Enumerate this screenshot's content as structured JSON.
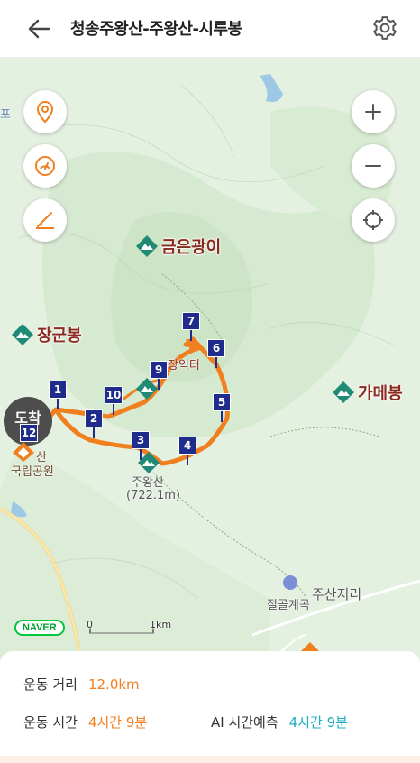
{
  "header": {
    "title": "청송주왕산-주왕산-시루봉",
    "back_icon": "arrow-left-icon",
    "settings_icon": "gear-icon"
  },
  "map": {
    "controls_left": [
      {
        "name": "location-pin-button",
        "icon": "location-pin-icon"
      },
      {
        "name": "speedometer-button",
        "icon": "speedometer-icon"
      },
      {
        "name": "elevation-slope-button",
        "icon": "slope-icon"
      }
    ],
    "controls_right": [
      {
        "name": "zoom-in-button",
        "icon": "plus-icon"
      },
      {
        "name": "zoom-out-button",
        "icon": "minus-icon"
      },
      {
        "name": "my-location-button",
        "icon": "crosshair-icon"
      }
    ],
    "peaks": [
      {
        "label": "금은광이"
      },
      {
        "label": "장군봉"
      },
      {
        "label": "가메봉"
      },
      {
        "label": ""
      }
    ],
    "summit_label": "주왕산",
    "summit_elevation": "(722.1m)",
    "park_label": "국립공원",
    "park_label_partial": "산",
    "edge_label": "포",
    "temple_label": "절골계곡",
    "area_label": "주산지리",
    "peak_partial_label": "장익터",
    "waypoints": [
      "1",
      "2",
      "3",
      "4",
      "5",
      "6",
      "7",
      "9",
      "10",
      "12"
    ],
    "finish_label": "도착",
    "naver_logo": "NAVER",
    "scale_start": "0",
    "scale_end": "1km",
    "route_color": "#f07f1f",
    "waypoint_color": "#1f2c8c"
  },
  "stats": {
    "distance_label": "운동 거리",
    "distance_value": "12.0km",
    "time_label": "운동 시간",
    "time_value": "4시간 9분",
    "ai_label": "AI 시간예측",
    "ai_value": "4시간 9분"
  }
}
